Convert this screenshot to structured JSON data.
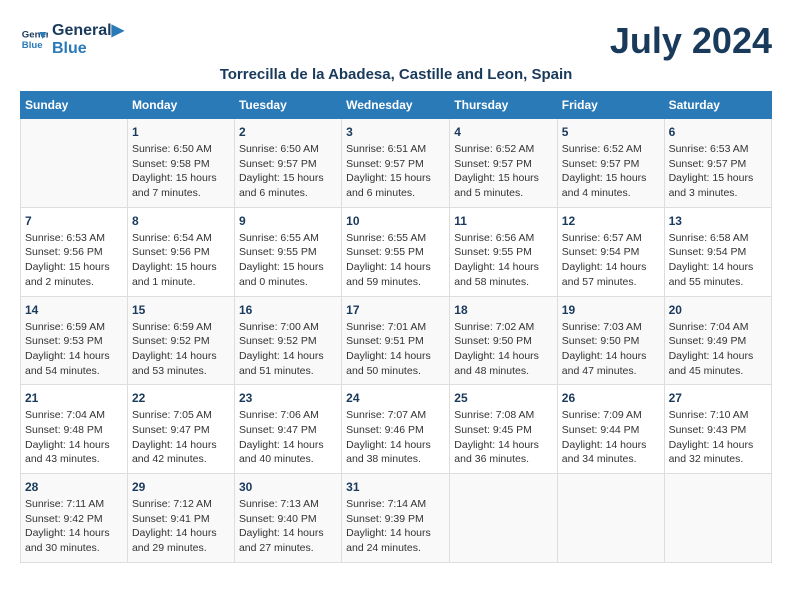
{
  "header": {
    "logo_line1": "General",
    "logo_line2": "Blue",
    "month_title": "July 2024",
    "subtitle": "Torrecilla de la Abadesa, Castille and Leon, Spain"
  },
  "weekdays": [
    "Sunday",
    "Monday",
    "Tuesday",
    "Wednesday",
    "Thursday",
    "Friday",
    "Saturday"
  ],
  "weeks": [
    [
      {
        "day": "",
        "info": ""
      },
      {
        "day": "1",
        "info": "Sunrise: 6:50 AM\nSunset: 9:58 PM\nDaylight: 15 hours\nand 7 minutes."
      },
      {
        "day": "2",
        "info": "Sunrise: 6:50 AM\nSunset: 9:57 PM\nDaylight: 15 hours\nand 6 minutes."
      },
      {
        "day": "3",
        "info": "Sunrise: 6:51 AM\nSunset: 9:57 PM\nDaylight: 15 hours\nand 6 minutes."
      },
      {
        "day": "4",
        "info": "Sunrise: 6:52 AM\nSunset: 9:57 PM\nDaylight: 15 hours\nand 5 minutes."
      },
      {
        "day": "5",
        "info": "Sunrise: 6:52 AM\nSunset: 9:57 PM\nDaylight: 15 hours\nand 4 minutes."
      },
      {
        "day": "6",
        "info": "Sunrise: 6:53 AM\nSunset: 9:57 PM\nDaylight: 15 hours\nand 3 minutes."
      }
    ],
    [
      {
        "day": "7",
        "info": "Sunrise: 6:53 AM\nSunset: 9:56 PM\nDaylight: 15 hours\nand 2 minutes."
      },
      {
        "day": "8",
        "info": "Sunrise: 6:54 AM\nSunset: 9:56 PM\nDaylight: 15 hours\nand 1 minute."
      },
      {
        "day": "9",
        "info": "Sunrise: 6:55 AM\nSunset: 9:55 PM\nDaylight: 15 hours\nand 0 minutes."
      },
      {
        "day": "10",
        "info": "Sunrise: 6:55 AM\nSunset: 9:55 PM\nDaylight: 14 hours\nand 59 minutes."
      },
      {
        "day": "11",
        "info": "Sunrise: 6:56 AM\nSunset: 9:55 PM\nDaylight: 14 hours\nand 58 minutes."
      },
      {
        "day": "12",
        "info": "Sunrise: 6:57 AM\nSunset: 9:54 PM\nDaylight: 14 hours\nand 57 minutes."
      },
      {
        "day": "13",
        "info": "Sunrise: 6:58 AM\nSunset: 9:54 PM\nDaylight: 14 hours\nand 55 minutes."
      }
    ],
    [
      {
        "day": "14",
        "info": "Sunrise: 6:59 AM\nSunset: 9:53 PM\nDaylight: 14 hours\nand 54 minutes."
      },
      {
        "day": "15",
        "info": "Sunrise: 6:59 AM\nSunset: 9:52 PM\nDaylight: 14 hours\nand 53 minutes."
      },
      {
        "day": "16",
        "info": "Sunrise: 7:00 AM\nSunset: 9:52 PM\nDaylight: 14 hours\nand 51 minutes."
      },
      {
        "day": "17",
        "info": "Sunrise: 7:01 AM\nSunset: 9:51 PM\nDaylight: 14 hours\nand 50 minutes."
      },
      {
        "day": "18",
        "info": "Sunrise: 7:02 AM\nSunset: 9:50 PM\nDaylight: 14 hours\nand 48 minutes."
      },
      {
        "day": "19",
        "info": "Sunrise: 7:03 AM\nSunset: 9:50 PM\nDaylight: 14 hours\nand 47 minutes."
      },
      {
        "day": "20",
        "info": "Sunrise: 7:04 AM\nSunset: 9:49 PM\nDaylight: 14 hours\nand 45 minutes."
      }
    ],
    [
      {
        "day": "21",
        "info": "Sunrise: 7:04 AM\nSunset: 9:48 PM\nDaylight: 14 hours\nand 43 minutes."
      },
      {
        "day": "22",
        "info": "Sunrise: 7:05 AM\nSunset: 9:47 PM\nDaylight: 14 hours\nand 42 minutes."
      },
      {
        "day": "23",
        "info": "Sunrise: 7:06 AM\nSunset: 9:47 PM\nDaylight: 14 hours\nand 40 minutes."
      },
      {
        "day": "24",
        "info": "Sunrise: 7:07 AM\nSunset: 9:46 PM\nDaylight: 14 hours\nand 38 minutes."
      },
      {
        "day": "25",
        "info": "Sunrise: 7:08 AM\nSunset: 9:45 PM\nDaylight: 14 hours\nand 36 minutes."
      },
      {
        "day": "26",
        "info": "Sunrise: 7:09 AM\nSunset: 9:44 PM\nDaylight: 14 hours\nand 34 minutes."
      },
      {
        "day": "27",
        "info": "Sunrise: 7:10 AM\nSunset: 9:43 PM\nDaylight: 14 hours\nand 32 minutes."
      }
    ],
    [
      {
        "day": "28",
        "info": "Sunrise: 7:11 AM\nSunset: 9:42 PM\nDaylight: 14 hours\nand 30 minutes."
      },
      {
        "day": "29",
        "info": "Sunrise: 7:12 AM\nSunset: 9:41 PM\nDaylight: 14 hours\nand 29 minutes."
      },
      {
        "day": "30",
        "info": "Sunrise: 7:13 AM\nSunset: 9:40 PM\nDaylight: 14 hours\nand 27 minutes."
      },
      {
        "day": "31",
        "info": "Sunrise: 7:14 AM\nSunset: 9:39 PM\nDaylight: 14 hours\nand 24 minutes."
      },
      {
        "day": "",
        "info": ""
      },
      {
        "day": "",
        "info": ""
      },
      {
        "day": "",
        "info": ""
      }
    ]
  ]
}
